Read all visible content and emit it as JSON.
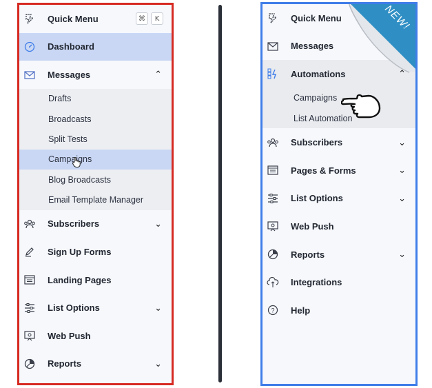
{
  "left_panel": {
    "quick_menu": {
      "label": "Quick Menu",
      "shortcut_keys": [
        "⌘",
        "K"
      ]
    },
    "items": [
      {
        "label": "Dashboard",
        "icon": "dashboard-icon",
        "active": true
      },
      {
        "label": "Messages",
        "icon": "envelope-icon",
        "expanded": true
      }
    ],
    "messages_subitems": [
      "Drafts",
      "Broadcasts",
      "Split Tests",
      "Campaigns",
      "Blog Broadcasts",
      "Email Template Manager"
    ],
    "active_subitem": "Campaigns",
    "lower_items": [
      {
        "label": "Subscribers",
        "icon": "subscribers-icon",
        "has_chevron": true
      },
      {
        "label": "Sign Up Forms",
        "icon": "pen-icon",
        "has_chevron": false
      },
      {
        "label": "Landing Pages",
        "icon": "page-icon",
        "has_chevron": false
      },
      {
        "label": "List Options",
        "icon": "sliders-icon",
        "has_chevron": true
      },
      {
        "label": "Web Push",
        "icon": "web-push-icon",
        "has_chevron": false
      },
      {
        "label": "Reports",
        "icon": "pie-chart-icon",
        "has_chevron": true
      }
    ]
  },
  "right_panel": {
    "badge": "NEW!",
    "items": [
      {
        "label": "Quick Menu",
        "icon": "quick-menu-icon"
      },
      {
        "label": "Messages",
        "icon": "envelope-icon"
      },
      {
        "label": "Automations",
        "icon": "automations-icon",
        "expanded": true
      }
    ],
    "automations_subitems": [
      "Campaigns",
      "List Automation"
    ],
    "lower_items": [
      {
        "label": "Subscribers",
        "icon": "subscribers-icon",
        "has_chevron": true
      },
      {
        "label": "Pages & Forms",
        "icon": "page-icon",
        "has_chevron": true
      },
      {
        "label": "List Options",
        "icon": "sliders-icon",
        "has_chevron": true
      },
      {
        "label": "Web Push",
        "icon": "web-push-icon",
        "has_chevron": false
      },
      {
        "label": "Reports",
        "icon": "pie-chart-icon",
        "has_chevron": true
      },
      {
        "label": "Integrations",
        "icon": "cloud-icon",
        "has_chevron": false
      },
      {
        "label": "Help",
        "icon": "help-icon",
        "has_chevron": false
      }
    ]
  },
  "colors": {
    "left_border": "#d62a22",
    "right_border": "#3f7de8",
    "active_bg": "#c9d7f4",
    "badge": "#2f8fc4"
  }
}
